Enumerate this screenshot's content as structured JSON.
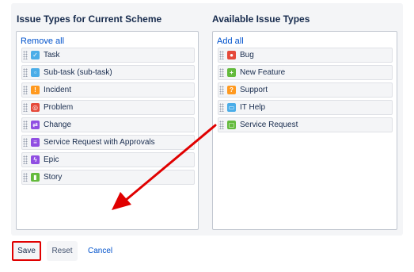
{
  "left": {
    "title": "Issue Types for Current Scheme",
    "action": "Remove all",
    "items": [
      {
        "label": "Task",
        "icon": "task-icon",
        "color": "#4bade8",
        "glyph": "✓"
      },
      {
        "label": "Sub-task (sub-task)",
        "icon": "subtask-icon",
        "color": "#4bade8",
        "glyph": "▫"
      },
      {
        "label": "Incident",
        "icon": "incident-icon",
        "color": "#ff991f",
        "glyph": "!"
      },
      {
        "label": "Problem",
        "icon": "problem-icon",
        "color": "#e5493a",
        "glyph": "◎"
      },
      {
        "label": "Change",
        "icon": "change-icon",
        "color": "#904ee2",
        "glyph": "⇄"
      },
      {
        "label": "Service Request with Approvals",
        "icon": "service-request-approvals-icon",
        "color": "#904ee2",
        "glyph": "≡"
      },
      {
        "label": "Epic",
        "icon": "epic-icon",
        "color": "#904ee2",
        "glyph": "ϟ"
      },
      {
        "label": "Story",
        "icon": "story-icon",
        "color": "#63ba3c",
        "glyph": "▮"
      }
    ]
  },
  "right": {
    "title": "Available Issue Types",
    "action": "Add all",
    "items": [
      {
        "label": "Bug",
        "icon": "bug-icon",
        "color": "#e5493a",
        "glyph": "●"
      },
      {
        "label": "New Feature",
        "icon": "new-feature-icon",
        "color": "#63ba3c",
        "glyph": "+"
      },
      {
        "label": "Support",
        "icon": "support-icon",
        "color": "#ff991f",
        "glyph": "?"
      },
      {
        "label": "IT Help",
        "icon": "it-help-icon",
        "color": "#4bade8",
        "glyph": "▭"
      },
      {
        "label": "Service Request",
        "icon": "service-request-icon",
        "color": "#63ba3c",
        "glyph": "▢"
      }
    ]
  },
  "footer": {
    "save_label": "Save",
    "reset_label": "Reset",
    "cancel_label": "Cancel"
  },
  "colors": {
    "annotation_red": "#e00000",
    "link_blue": "#0052cc",
    "panel_bg": "#f4f5f7"
  }
}
